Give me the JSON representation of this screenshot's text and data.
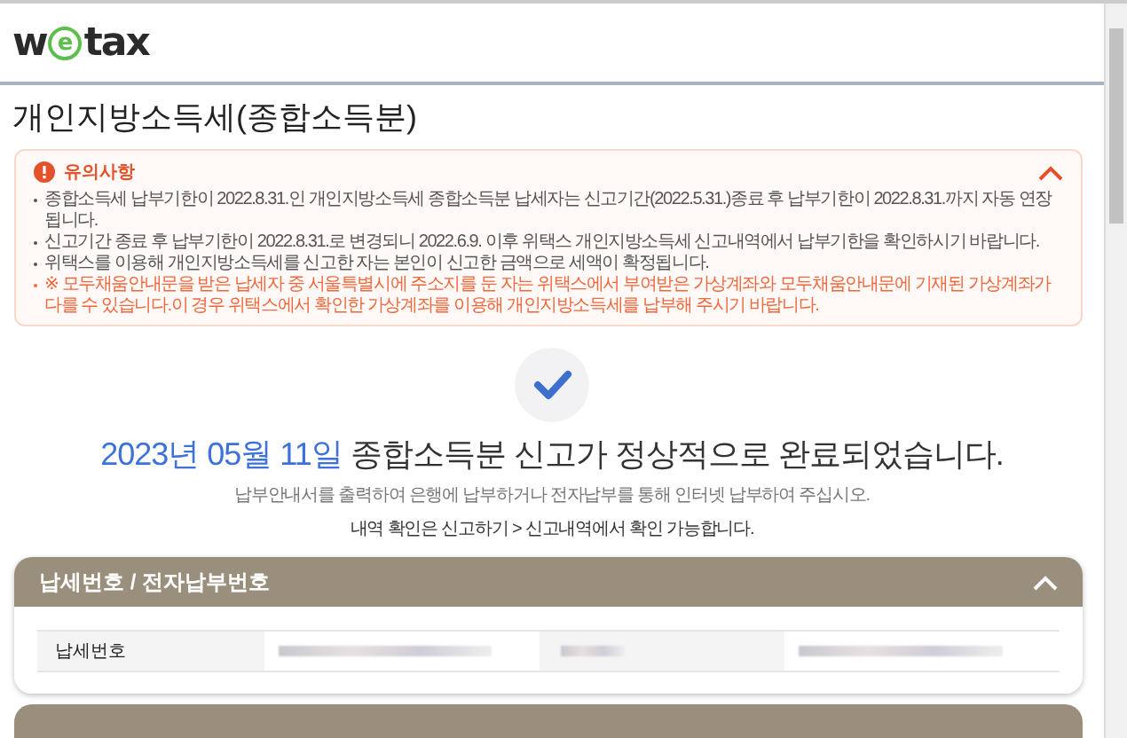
{
  "logo": "wetax",
  "page_title": "개인지방소득세(종합소득분)",
  "notice": {
    "title": "유의사항",
    "expanded": true,
    "items": [
      {
        "kind": "normal",
        "text": "종합소득세 납부기한이 2022.8.31.인 개인지방소득세 종합소득분 납세자는 신고기간(2022.5.31.)종료 후 납부기한이 2022.8.31.까지 자동 연장됩니다."
      },
      {
        "kind": "normal",
        "text": "신고기간 종료 후 납부기한이 2022.8.31.로 변경되니 2022.6.9. 이후 위택스 개인지방소득세 신고내역에서 납부기한을 확인하시기 바랍니다."
      },
      {
        "kind": "normal",
        "text": "위택스를 이용해 개인지방소득세를 신고한 자는 본인이 신고한 금액으로 세액이 확정됩니다."
      },
      {
        "kind": "warning",
        "text": "※ 모두채움안내문을 받은 납세자 중 서울특별시에 주소지를 둔 자는 위택스에서 부여받은 가상계좌와 모두채움안내문에 기재된 가상계좌가 다를 수 있습니다.이 경우 위택스에서 확인한 가상계좌를 이용해 개인지방소득세를 납부해 주시기 바랍니다."
      }
    ]
  },
  "result": {
    "date": "2023년 05월 11일",
    "message": "종합소득분 신고가 정상적으로 완료되었습니다.",
    "lines": [
      "납부안내서를 출력하여 은행에 납부하거나 전자납부를 통해 인터넷 납부하여 주십시오.",
      "내역 확인은 신고하기 > 신고내역에서 확인 가능합니다."
    ]
  },
  "section": {
    "title": "납세번호 / 전자납부번호",
    "expanded": true,
    "rows": [
      {
        "label": "납세번호"
      }
    ]
  }
}
